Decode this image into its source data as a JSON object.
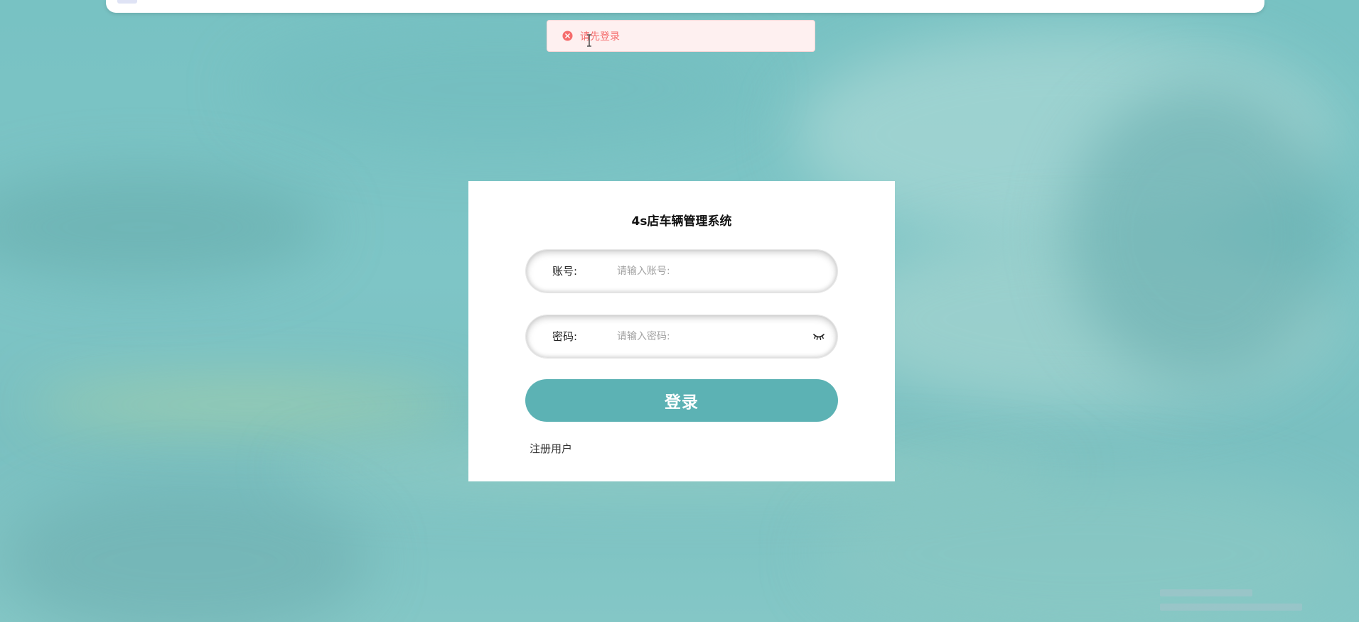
{
  "toast": {
    "message": "请先登录",
    "type": "error",
    "icon": "error-circle-icon",
    "color": "#f56c6c"
  },
  "login": {
    "title": "4s店车辆管理系统",
    "account_label": "账号:",
    "account_placeholder": "请输入账号:",
    "account_value": "",
    "password_label": "密码:",
    "password_placeholder": "请输入密码:",
    "password_value": "",
    "password_toggle_icon": "eye-closed-icon",
    "submit_label": "登录",
    "register_label": "注册用户"
  },
  "colors": {
    "accent": "#5cb2b4",
    "background": "#7cc4c4"
  }
}
